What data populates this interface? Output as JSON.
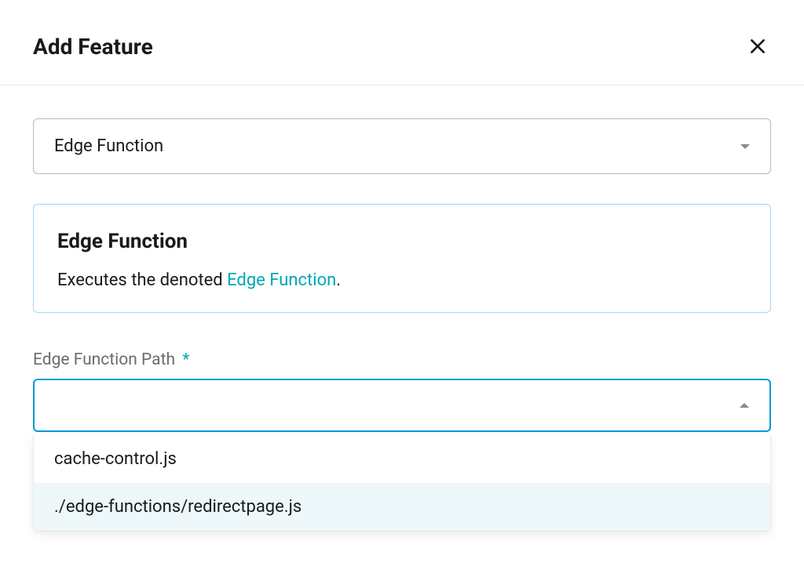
{
  "dialog": {
    "title": "Add Feature"
  },
  "feature_select": {
    "value": "Edge Function"
  },
  "info_panel": {
    "title": "Edge Function",
    "desc_prefix": "Executes the denoted ",
    "link_text": "Edge Function",
    "desc_suffix": "."
  },
  "path_field": {
    "label": "Edge Function Path ",
    "required_mark": "*",
    "value": ""
  },
  "path_dropdown": {
    "options": [
      {
        "label": "cache-control.js"
      },
      {
        "label": "./edge-functions/redirectpage.js"
      }
    ],
    "hovered_index": 1
  }
}
